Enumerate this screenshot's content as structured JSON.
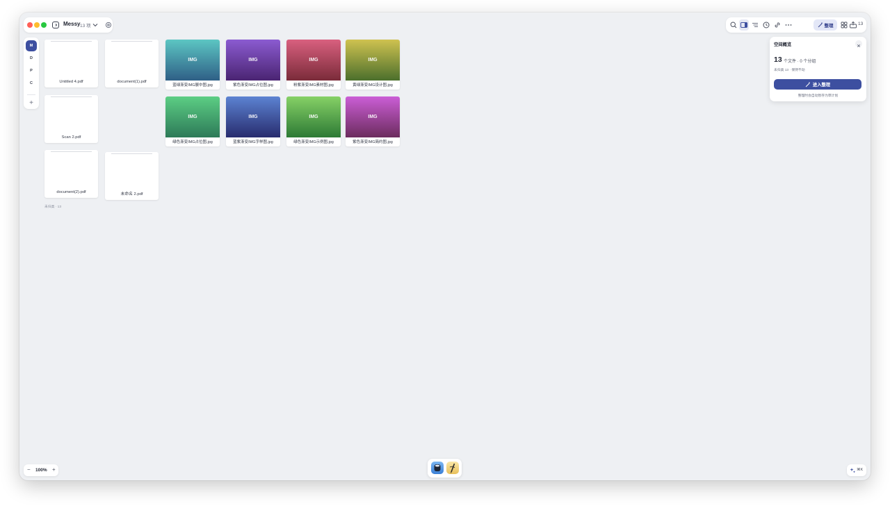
{
  "window": {
    "space_name": "Messy",
    "space_count": "13 项",
    "traffic_lights": {
      "close": "#ff5f57",
      "minimize": "#febc2e",
      "zoom": "#28c840"
    }
  },
  "toolbar": {
    "icons": [
      "search-icon",
      "sidebar-view-icon",
      "list-view-icon",
      "history-icon",
      "link-icon",
      "more-icon"
    ],
    "organize_label": "整理",
    "share_count": "13"
  },
  "rail": {
    "items": [
      {
        "letter": "M",
        "active": true
      },
      {
        "letter": "D",
        "active": false
      },
      {
        "letter": "P",
        "active": false
      },
      {
        "letter": "C",
        "active": false
      }
    ],
    "add_label": "+"
  },
  "files": {
    "pdfs": [
      {
        "name": "Untitled 4.pdf"
      },
      {
        "name": "document(1).pdf"
      },
      {
        "name": "Scan 2.pdf"
      },
      {
        "name": "document(2).pdf"
      },
      {
        "name": "未命名 2.pdf"
      }
    ],
    "images": [
      {
        "name": "蓝绿渐变IMG展中图.jpg",
        "thumb_label": "IMG",
        "colors": [
          "#5cc6c3",
          "#2f5f86"
        ]
      },
      {
        "name": "紫色渐变IMG占位图.jpg",
        "thumb_label": "IMG",
        "colors": [
          "#8b5bd1",
          "#4a2472"
        ]
      },
      {
        "name": "粉紫渐变IMG素材图.jpg",
        "thumb_label": "IMG",
        "colors": [
          "#d9607f",
          "#7a2b39"
        ]
      },
      {
        "name": "黄绿渐变IMG设计图.jpg",
        "thumb_label": "IMG",
        "colors": [
          "#cfc250",
          "#4b6f2c"
        ]
      },
      {
        "name": "绿色渐变IMG占位图.jpg",
        "thumb_label": "IMG",
        "colors": [
          "#5cce84",
          "#2d7a58"
        ]
      },
      {
        "name": "蓝紫渐变IMG字样图.jpg",
        "thumb_label": "IMG",
        "colors": [
          "#5c83d2",
          "#282c6e"
        ]
      },
      {
        "name": "绿色渐变IMG示例图.jpg",
        "thumb_label": "IMG",
        "colors": [
          "#86d166",
          "#2d7a35"
        ]
      },
      {
        "name": "紫色渐变IMG简约图.jpg",
        "thumb_label": "IMG",
        "colors": [
          "#cb5ed6",
          "#6c2c5e"
        ]
      }
    ],
    "unarchived_label": "未归类 · 13"
  },
  "overview": {
    "title": "空间概览",
    "count": "13",
    "count_sub": "个文件 · 0 个分组",
    "status": "未归类 13 · 保持不动",
    "enter_button": "进入整理",
    "hint": "整理时会自动暂存为草计划"
  },
  "zoom": {
    "minus": "−",
    "value": "100%",
    "plus": "+"
  },
  "assistant": {
    "shortcut": "⌘K"
  },
  "accent": "#3d4fa0"
}
